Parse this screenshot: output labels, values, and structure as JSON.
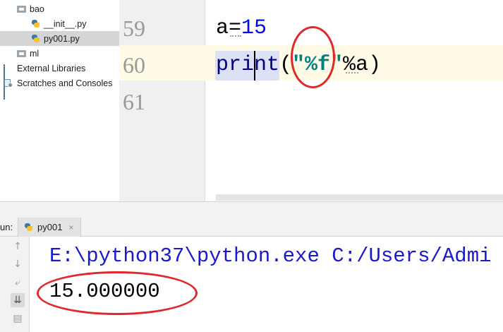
{
  "project_tree": {
    "items": [
      {
        "label": "bao",
        "icon": "folder-icon"
      },
      {
        "label": "__init__.py",
        "icon": "python-file-icon"
      },
      {
        "label": "py001.py",
        "icon": "python-file-icon",
        "selected": true
      },
      {
        "label": "ml",
        "icon": "folder-icon"
      },
      {
        "label": "External Libraries",
        "icon": "libraries-icon"
      },
      {
        "label": "Scratches and Consoles",
        "icon": "scratches-icon"
      }
    ]
  },
  "editor": {
    "line_numbers": [
      "59",
      "60",
      "61"
    ],
    "line59": {
      "var": "a",
      "op": "=",
      "num": "15"
    },
    "line60": {
      "fn": "print",
      "open": "(",
      "str": "\"%f\"",
      "rest": "%a",
      "close": ")"
    },
    "current_line_color": "#fffbe6"
  },
  "run_panel": {
    "label": "un:",
    "tab": "py001",
    "toolbar": [
      "arrow-up-icon",
      "arrow-down-icon",
      "soft-wrap-icon",
      "scroll-to-end-icon",
      "print-icon"
    ],
    "command": "E:\\python37\\python.exe C:/Users/Admi",
    "output": "15.000000"
  },
  "colors": {
    "annotation": "#e0282a",
    "keyword": "#000080",
    "number": "#0000ff",
    "string": "#008080",
    "console_command": "#1a1acd"
  }
}
